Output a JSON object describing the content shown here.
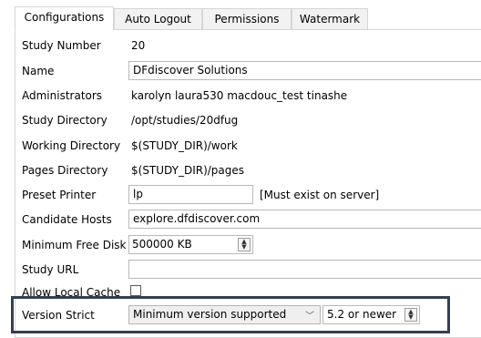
{
  "tabs": [
    {
      "label": "Configurations",
      "active": true
    },
    {
      "label": "Auto Logout",
      "active": false
    },
    {
      "label": "Permissions",
      "active": false
    },
    {
      "label": "Watermark",
      "active": false
    }
  ],
  "form": {
    "study_number": {
      "label": "Study Number",
      "value": "20"
    },
    "name": {
      "label": "Name",
      "value": "DFdiscover Solutions"
    },
    "administrators": {
      "label": "Administrators",
      "value": "karolyn laura530 macdouc_test tinashe"
    },
    "study_directory": {
      "label": "Study Directory",
      "value": "/opt/studies/20dfug"
    },
    "working_directory": {
      "label": "Working Directory",
      "value": "$(STUDY_DIR)/work"
    },
    "pages_directory": {
      "label": "Pages Directory",
      "value": "$(STUDY_DIR)/pages"
    },
    "preset_printer": {
      "label": "Preset Printer",
      "value": "lp",
      "note": "[Must exist on server]"
    },
    "candidate_hosts": {
      "label": "Candidate Hosts",
      "value": "explore.dfdiscover.com"
    },
    "minimum_free_disk": {
      "label": "Minimum Free Disk",
      "value": "500000 KB"
    },
    "study_url": {
      "label": "Study URL",
      "value": ""
    },
    "allow_local_cache": {
      "label": "Allow Local Cache",
      "checked": false
    },
    "version_strict": {
      "label": "Version Strict",
      "mode": "Minimum version supported",
      "version": "5.2 or newer"
    }
  },
  "colors": {
    "highlight_border": "#333f54",
    "tab_border": "#d6d6d6"
  }
}
